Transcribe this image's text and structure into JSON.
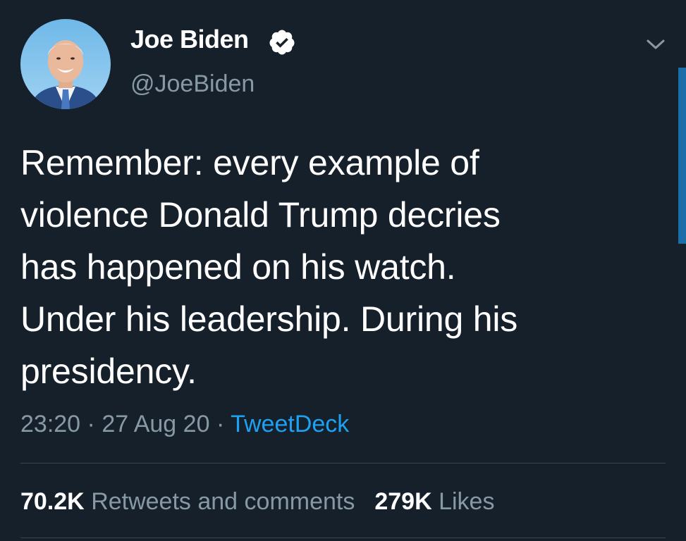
{
  "author": {
    "display_name": "Joe Biden",
    "handle": "@JoeBiden",
    "verified": true,
    "avatar_icon": "profile-photo"
  },
  "tweet": {
    "lines": [
      "Remember: every example of",
      "violence Donald Trump decries",
      "has happened on his watch.",
      "Under his leadership. During his",
      "presidency."
    ],
    "time": "23:20",
    "separator": "·",
    "date": "27 Aug 20",
    "source": "TweetDeck"
  },
  "stats": {
    "retweets_count": "70.2K",
    "retweets_label": "Retweets and comments",
    "likes_count": "279K",
    "likes_label": "Likes"
  },
  "colors": {
    "background": "#15202b",
    "primary_text": "#ffffff",
    "secondary_text": "#8899a6",
    "accent": "#1da1f2",
    "divider": "#38444d"
  },
  "icons": {
    "verified": "verified-badge-icon",
    "menu": "chevron-down-icon"
  }
}
